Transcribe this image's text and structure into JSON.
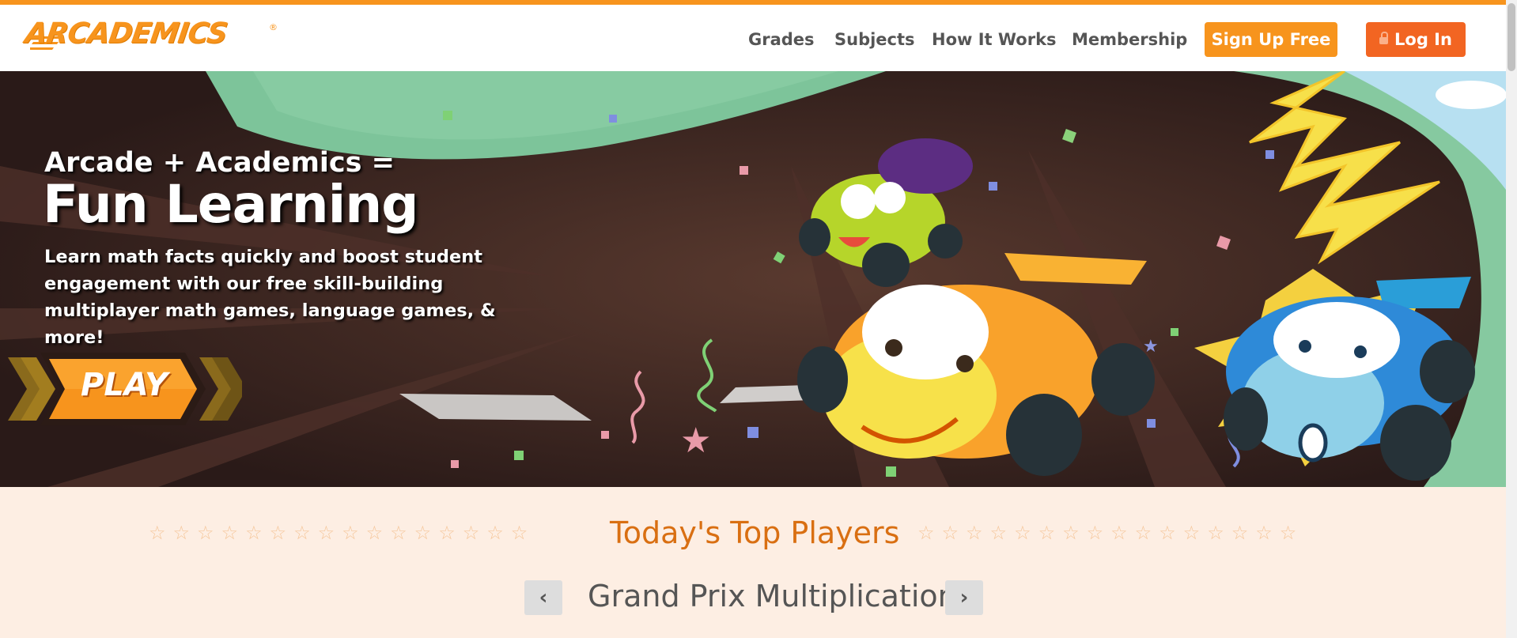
{
  "brand": {
    "logo_text": "ARCADEMICS",
    "registered": "®",
    "color": "#f7941d"
  },
  "nav": {
    "links": [
      "Grades",
      "Subjects",
      "How It Works",
      "Membership"
    ],
    "signup_label": "Sign Up Free",
    "login_label": "Log In"
  },
  "hero": {
    "subtitle": "Arcade + Academics =",
    "title": "Fun Learning",
    "description": "Learn math facts quickly and boost student engagement with our free skill-building multiplayer math games, language games, & more!",
    "play_label": "PLAY"
  },
  "leaderboard": {
    "heading": "Today's Top Players",
    "game": "Grand Prix Multiplication",
    "prev_icon": "chevron-left-icon",
    "next_icon": "chevron-right-icon",
    "prev_glyph": "‹",
    "next_glyph": "›",
    "stars_left": "☆☆☆☆☆☆☆☆☆☆☆☆☆☆☆☆",
    "stars_right": "☆☆☆☆☆☆☆☆☆☆☆☆☆☆☆☆"
  },
  "colors": {
    "accent": "#f7941d",
    "login": "#f26522",
    "heading": "#d96f12",
    "lower_bg": "#fdeee3"
  }
}
